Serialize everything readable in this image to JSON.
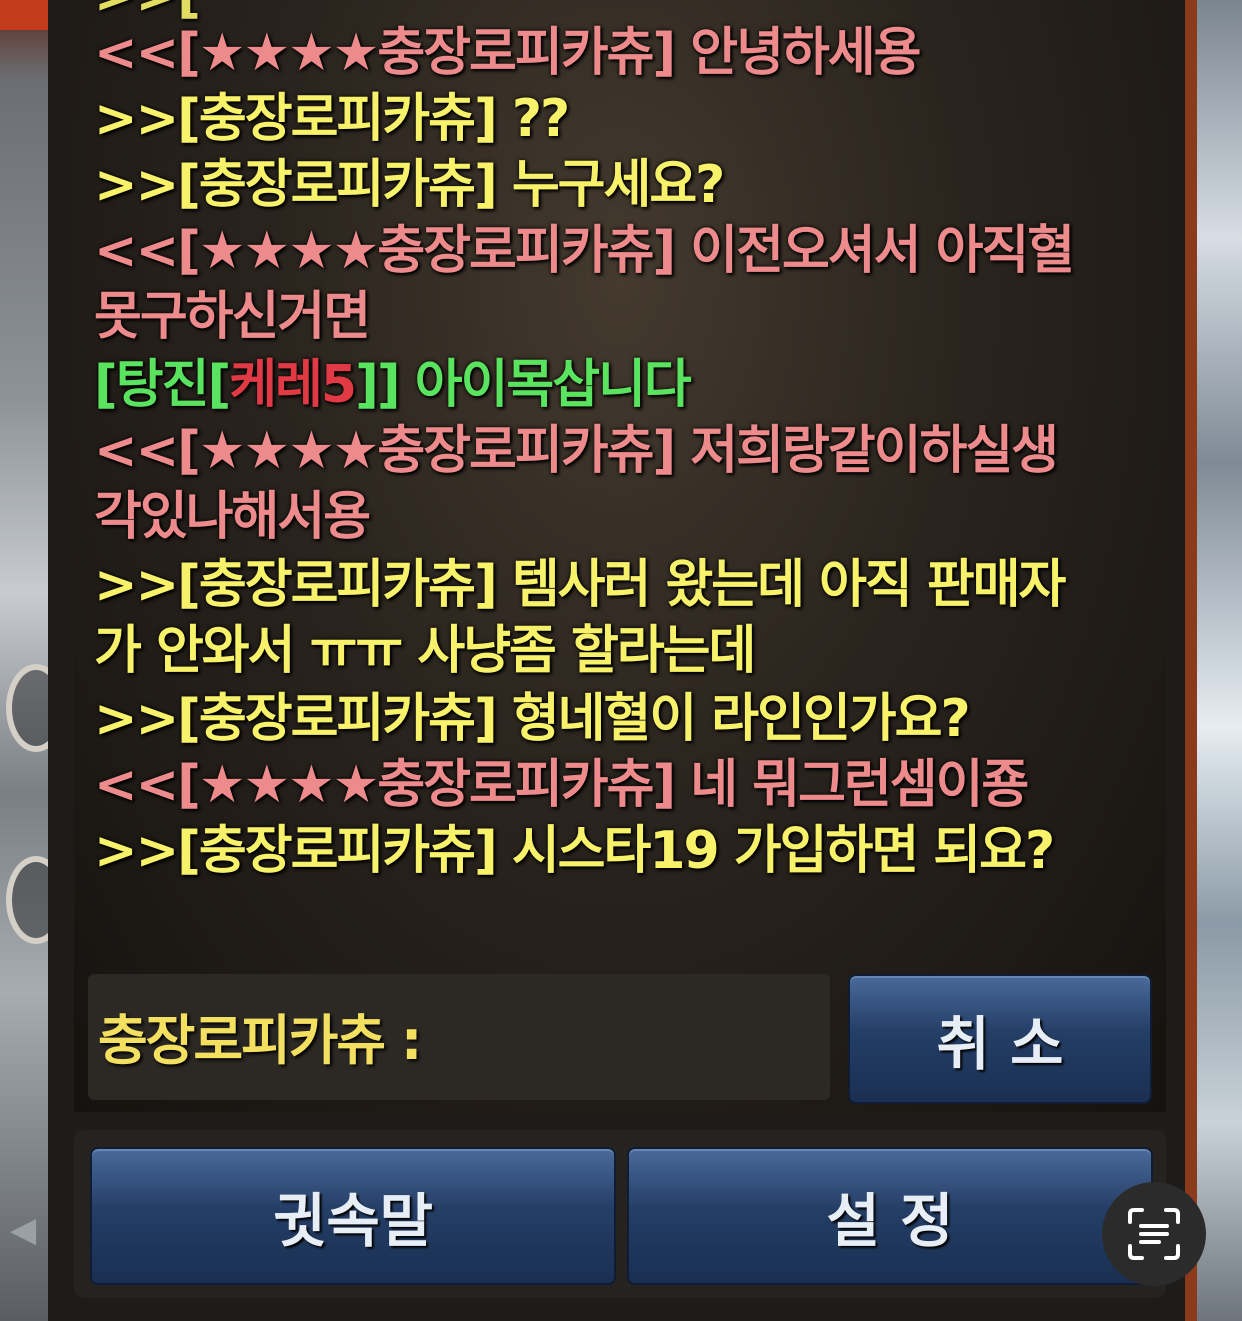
{
  "chat": {
    "messages": [
      {
        "type": "incoming",
        "text": "<<[★★★★충장로피카츄] 안녕하세용"
      },
      {
        "type": "outgoing",
        "text": ">>[충장로피카츄] ??"
      },
      {
        "type": "outgoing",
        "text": ">>[충장로피카츄] 누구세요?"
      },
      {
        "type": "incoming",
        "text": "<<[★★★★충장로피카츄] 이전오셔서 아직혈\n못구하신거면"
      },
      {
        "type": "shout",
        "prefix": "[탕진[",
        "guild": "케레5",
        "suffix": "]] 아이목삽니다"
      },
      {
        "type": "incoming",
        "text": "<<[★★★★충장로피카츄] 저희랑같이하실생\n각있나해서용"
      },
      {
        "type": "outgoing",
        "text": ">>[충장로피카츄] 템사러 왔는데 아직 판매자\n가 안와서 ㅠㅠ 사냥좀 할라는데"
      },
      {
        "type": "outgoing",
        "text": ">>[충장로피카츄] 형네혈이 라인인가요?"
      },
      {
        "type": "incoming",
        "text": "<<[★★★★충장로피카츄] 네 뭐그런셈이죵"
      },
      {
        "type": "outgoing",
        "text": ">>[충장로피카츄] 시스타19 가입하면 되요?"
      }
    ]
  },
  "input": {
    "label": "충장로피카츄 :"
  },
  "buttons": {
    "cancel": "취 소",
    "whisper": "귓속말",
    "settings": "설 정"
  },
  "colors": {
    "incoming": "#ec8a8c",
    "outgoing": "#f7f26a",
    "shout": "#59e35e",
    "guild": "#e23a44",
    "button": "#243e66"
  },
  "icons": {
    "ocr": "text-scan-icon",
    "side_arrow": "arrow-left-icon"
  }
}
